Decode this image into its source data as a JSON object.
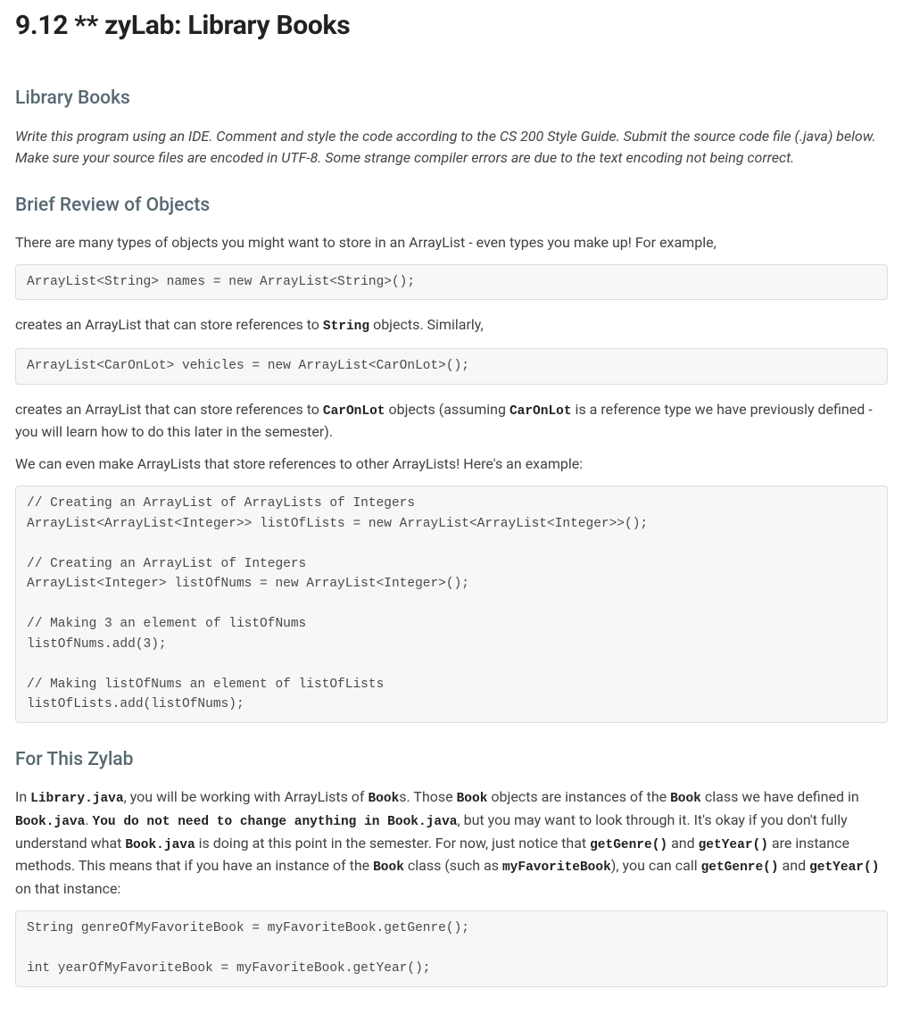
{
  "page_title": "9.12 ** zyLab: Library Books",
  "section1": {
    "heading": "Library Books",
    "intro": "Write this program using an IDE. Comment and style the code according to the CS 200 Style Guide. Submit the source code file (.java) below. Make sure your source files are encoded in UTF-8. Some strange compiler errors are due to the text encoding not being correct."
  },
  "section2": {
    "heading": "Brief Review of Objects",
    "para1": "There are many types of objects you might want to store in an ArrayList - even types you make up! For example,",
    "code1": "ArrayList<String> names = new ArrayList<String>();",
    "para2_pre": "creates an ArrayList that can store references to ",
    "para2_mono": "String",
    "para2_post": " objects. Similarly,",
    "code2": "ArrayList<CarOnLot> vehicles = new ArrayList<CarOnLot>();",
    "para3_a": "creates an ArrayList that can store references to ",
    "para3_m1": "CarOnLot",
    "para3_b": " objects (assuming ",
    "para3_m2": "CarOnLot",
    "para3_c": " is a reference type we have previously defined - you will learn how to do this later in the semester).",
    "para4": "We can even make ArrayLists that store references to other ArrayLists! Here's an example:",
    "code3": "// Creating an ArrayList of ArrayLists of Integers\nArrayList<ArrayList<Integer>> listOfLists = new ArrayList<ArrayList<Integer>>();\n\n// Creating an ArrayList of Integers\nArrayList<Integer> listOfNums = new ArrayList<Integer>();\n\n// Making 3 an element of listOfNums\nlistOfNums.add(3);\n\n// Making listOfNums an element of listOfLists\nlistOfLists.add(listOfNums);"
  },
  "section3": {
    "heading": "For This Zylab",
    "p": {
      "t1": "In ",
      "m1": "Library.java",
      "t2": ", you will be working with ArrayLists of ",
      "m2": "Book",
      "t3": "s. Those ",
      "m3": "Book",
      "t4": " objects are instances of the ",
      "m4": "Book",
      "t5": " class we have defined in ",
      "m5": "Book.java",
      "t6": ". ",
      "bold": "You do not need to change anything in Book.java",
      "t7": ", but you may want to look through it. It's okay if you don't fully understand what ",
      "m6": "Book.java",
      "t8": " is doing at this point in the semester. For now, just notice that ",
      "m7": "getGenre()",
      "t9": " and ",
      "m8": "getYear()",
      "t10": " are instance methods. This means that if you have an instance of the ",
      "m9": "Book",
      "t11": " class (such as ",
      "m10": "myFavoriteBook",
      "t12": "), you can call ",
      "m11": "getGenre()",
      "t13": " and ",
      "m12": "getYear()",
      "t14": " on that instance:"
    },
    "code": "String genreOfMyFavoriteBook = myFavoriteBook.getGenre();\n\nint yearOfMyFavoriteBook = myFavoriteBook.getYear();"
  }
}
